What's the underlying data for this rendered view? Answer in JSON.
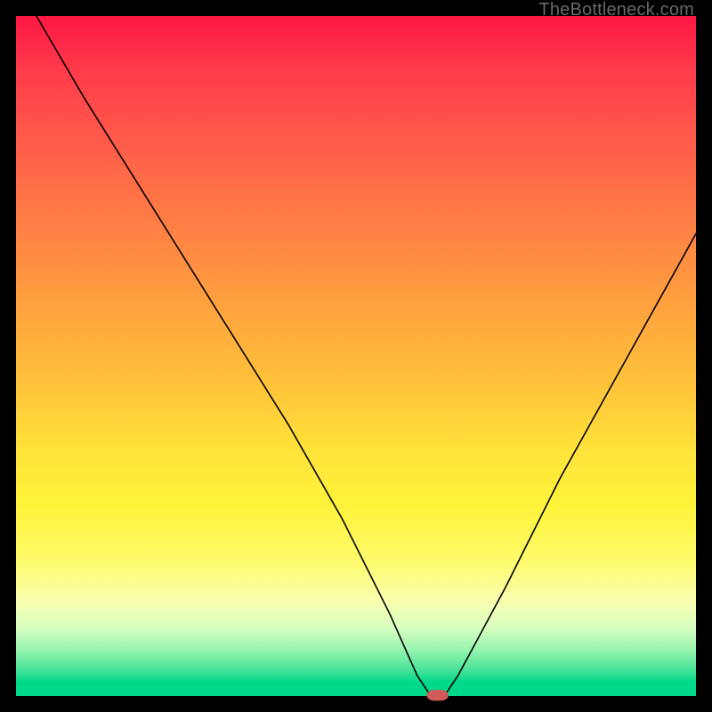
{
  "watermark": "TheBottleneck.com",
  "chart_data": {
    "type": "line",
    "title": "",
    "xlabel": "",
    "ylabel": "",
    "xlim": [
      0,
      100
    ],
    "ylim": [
      0,
      100
    ],
    "grid": false,
    "legend": false,
    "series": [
      {
        "name": "bottleneck-curve",
        "x": [
          3,
          10,
          20,
          30,
          40,
          48,
          55,
          59,
          61,
          63,
          65,
          72,
          80,
          90,
          100
        ],
        "values": [
          100,
          88,
          72,
          56,
          40,
          26,
          12,
          3,
          0,
          0,
          3,
          16,
          32,
          50,
          68
        ]
      }
    ],
    "marker": {
      "name": "optimal-point",
      "x": 62,
      "y": 0,
      "color": "#d05a5a"
    }
  }
}
